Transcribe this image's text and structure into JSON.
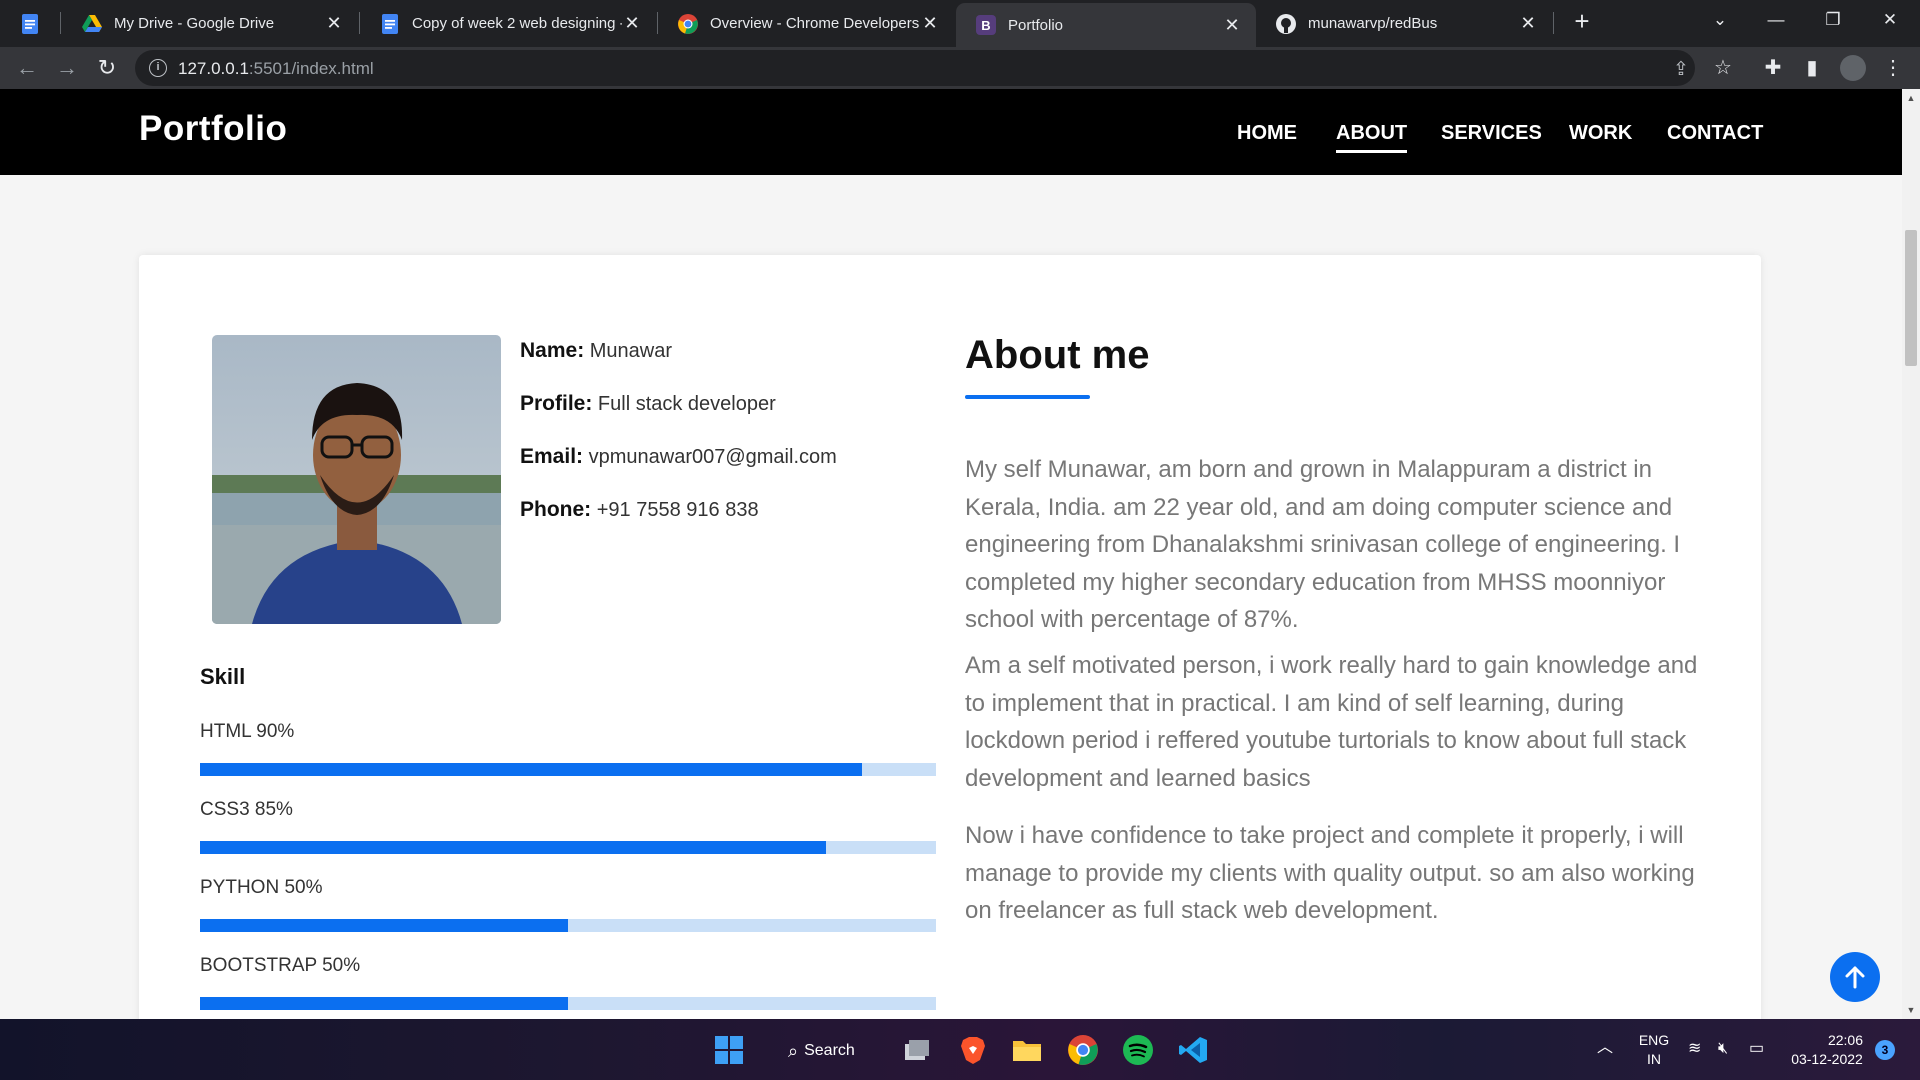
{
  "browser": {
    "tabs": [
      {
        "title": "",
        "icon": "google-docs-icon"
      },
      {
        "title": "My Drive - Google Drive",
        "icon": "google-drive-icon"
      },
      {
        "title": "Copy of week 2 web designing -",
        "icon": "google-docs-icon"
      },
      {
        "title": "Overview - Chrome Developers",
        "icon": "chrome-icon"
      },
      {
        "title": "Portfolio",
        "icon": "bootstrap-icon",
        "active": true
      },
      {
        "title": "munawarvp/redBus",
        "icon": "github-icon"
      }
    ],
    "url_host": "127.0.0.1",
    "url_rest": ":5501/index.html"
  },
  "site": {
    "brand": "Portfolio",
    "nav": [
      "HOME",
      "ABOUT",
      "SERVICES",
      "WORK",
      "CONTACT"
    ],
    "active_nav": "ABOUT"
  },
  "profile": {
    "name_label": "Name:",
    "name": "Munawar",
    "profile_label": "Profile:",
    "profile": "Full stack developer",
    "email_label": "Email:",
    "email": "vpmunawar007@gmail.com",
    "phone_label": "Phone:",
    "phone": "+91 7558 916 838"
  },
  "skills": {
    "heading": "Skill",
    "items": [
      {
        "label": "HTML 90%",
        "level": 0.9
      },
      {
        "label": "CSS3 85%",
        "level": 0.85
      },
      {
        "label": "PYTHON 50%",
        "level": 0.5
      },
      {
        "label": "BOOTSTRAP 50%",
        "level": 0.5
      }
    ]
  },
  "about": {
    "title": "About me",
    "paragraphs": [
      "My self Munawar, am born and grown in Malappuram a district in Kerala, India. am 22 year old, and am doing computer science and engineering from Dhanalakshmi srinivasan college of engineering. I completed my higher secondary education from MHSS moonniyor school with percentage of 87%.",
      "Am a self motivated person, i work really hard to gain knowledge and to implement that in practical. I am kind of self learning, during lockdown period i reffered youtube turtorials to know about full stack development and learned basics",
      "Now i have confidence to take project and complete it properly, i will manage to provide my clients with quality output. so am also working on freelancer as full stack web development."
    ]
  },
  "taskbar": {
    "search_label": "Search",
    "lang_top": "ENG",
    "lang_bottom": "IN",
    "time": "22:06",
    "date": "03-12-2022",
    "notification_count": "3"
  },
  "colors": {
    "accent": "#0b6ff0",
    "bar_track": "#c9dff7",
    "nav_bg": "#000000"
  }
}
